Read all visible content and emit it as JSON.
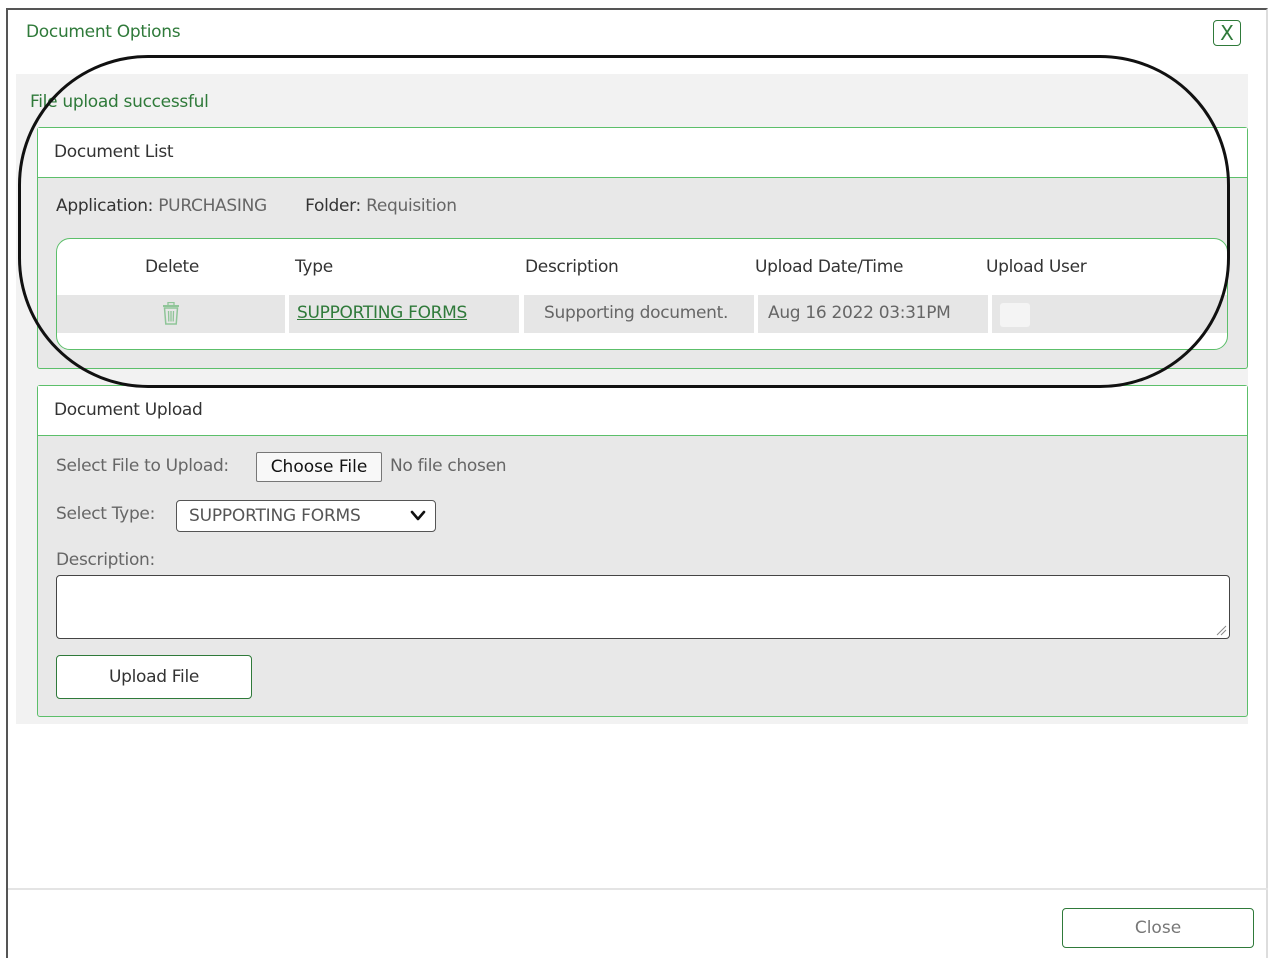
{
  "dialog": {
    "title": "Document Options",
    "close_x_label": "X"
  },
  "status_message": "File upload successful",
  "document_list": {
    "title": "Document List",
    "application_label": "Application:",
    "application_value": "PURCHASING",
    "folder_label": "Folder:",
    "folder_value": "Requisition",
    "columns": [
      "Delete",
      "Type",
      "Description",
      "Upload Date/Time",
      "Upload User"
    ],
    "rows": [
      {
        "delete_icon": "trash-icon",
        "type": "SUPPORTING FORMS",
        "description": "Supporting document.",
        "upload_datetime": "Aug 16 2022 03:31PM",
        "upload_user": ""
      }
    ]
  },
  "document_upload": {
    "title": "Document Upload",
    "select_file_label": "Select File to Upload:",
    "choose_file_button": "Choose File",
    "no_file_text": "No file chosen",
    "select_type_label": "Select Type:",
    "select_type_value": "SUPPORTING FORMS",
    "description_label": "Description:",
    "description_value": "",
    "upload_button": "Upload File"
  },
  "footer": {
    "close_button": "Close"
  },
  "colors": {
    "accent_green": "#2f7a3a",
    "border_green": "#5cbf6a",
    "panel_gray": "#e8e8e8"
  }
}
